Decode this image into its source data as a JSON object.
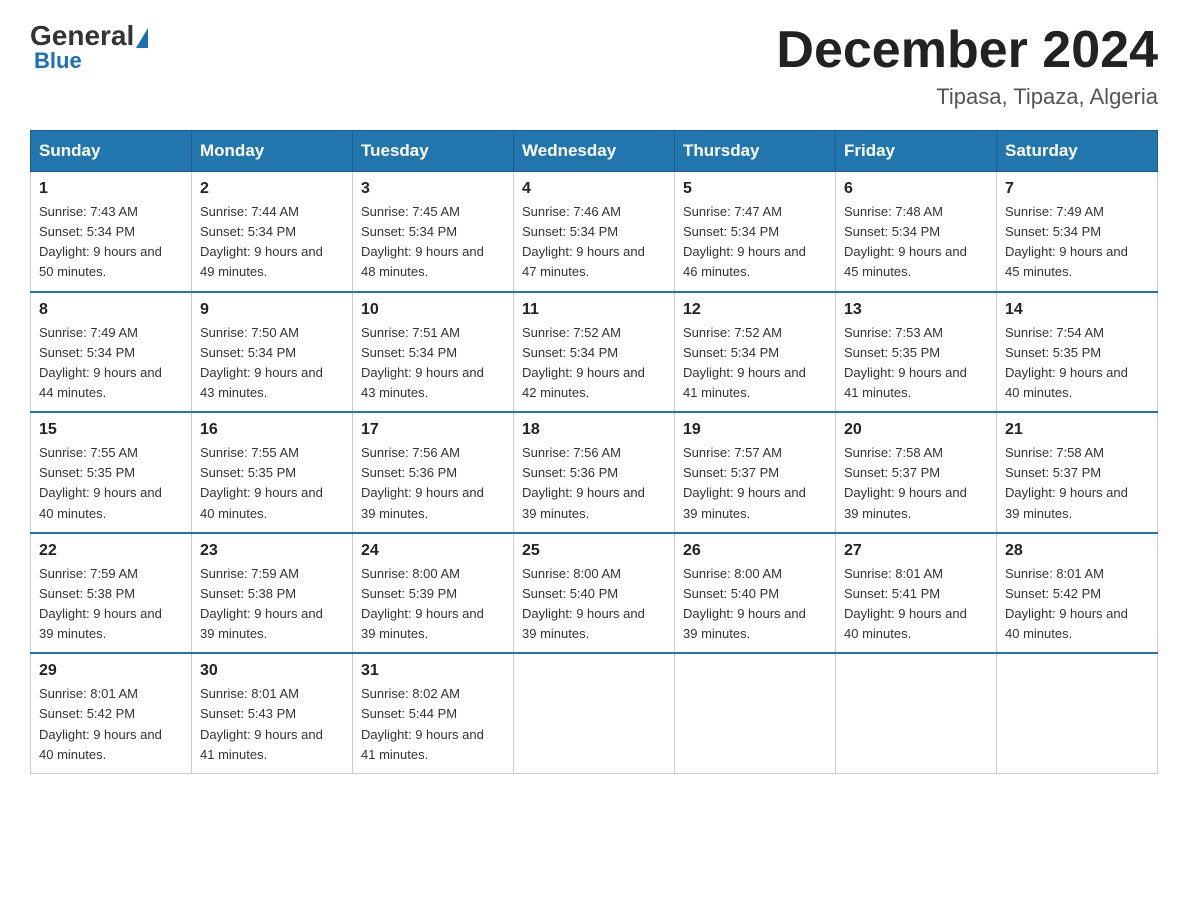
{
  "header": {
    "logo": {
      "general": "General",
      "blue": "Blue"
    },
    "title": "December 2024",
    "location": "Tipasa, Tipaza, Algeria"
  },
  "calendar": {
    "days_of_week": [
      "Sunday",
      "Monday",
      "Tuesday",
      "Wednesday",
      "Thursday",
      "Friday",
      "Saturday"
    ],
    "weeks": [
      [
        {
          "day": "1",
          "sunrise": "7:43 AM",
          "sunset": "5:34 PM",
          "daylight": "9 hours and 50 minutes."
        },
        {
          "day": "2",
          "sunrise": "7:44 AM",
          "sunset": "5:34 PM",
          "daylight": "9 hours and 49 minutes."
        },
        {
          "day": "3",
          "sunrise": "7:45 AM",
          "sunset": "5:34 PM",
          "daylight": "9 hours and 48 minutes."
        },
        {
          "day": "4",
          "sunrise": "7:46 AM",
          "sunset": "5:34 PM",
          "daylight": "9 hours and 47 minutes."
        },
        {
          "day": "5",
          "sunrise": "7:47 AM",
          "sunset": "5:34 PM",
          "daylight": "9 hours and 46 minutes."
        },
        {
          "day": "6",
          "sunrise": "7:48 AM",
          "sunset": "5:34 PM",
          "daylight": "9 hours and 45 minutes."
        },
        {
          "day": "7",
          "sunrise": "7:49 AM",
          "sunset": "5:34 PM",
          "daylight": "9 hours and 45 minutes."
        }
      ],
      [
        {
          "day": "8",
          "sunrise": "7:49 AM",
          "sunset": "5:34 PM",
          "daylight": "9 hours and 44 minutes."
        },
        {
          "day": "9",
          "sunrise": "7:50 AM",
          "sunset": "5:34 PM",
          "daylight": "9 hours and 43 minutes."
        },
        {
          "day": "10",
          "sunrise": "7:51 AM",
          "sunset": "5:34 PM",
          "daylight": "9 hours and 43 minutes."
        },
        {
          "day": "11",
          "sunrise": "7:52 AM",
          "sunset": "5:34 PM",
          "daylight": "9 hours and 42 minutes."
        },
        {
          "day": "12",
          "sunrise": "7:52 AM",
          "sunset": "5:34 PM",
          "daylight": "9 hours and 41 minutes."
        },
        {
          "day": "13",
          "sunrise": "7:53 AM",
          "sunset": "5:35 PM",
          "daylight": "9 hours and 41 minutes."
        },
        {
          "day": "14",
          "sunrise": "7:54 AM",
          "sunset": "5:35 PM",
          "daylight": "9 hours and 40 minutes."
        }
      ],
      [
        {
          "day": "15",
          "sunrise": "7:55 AM",
          "sunset": "5:35 PM",
          "daylight": "9 hours and 40 minutes."
        },
        {
          "day": "16",
          "sunrise": "7:55 AM",
          "sunset": "5:35 PM",
          "daylight": "9 hours and 40 minutes."
        },
        {
          "day": "17",
          "sunrise": "7:56 AM",
          "sunset": "5:36 PM",
          "daylight": "9 hours and 39 minutes."
        },
        {
          "day": "18",
          "sunrise": "7:56 AM",
          "sunset": "5:36 PM",
          "daylight": "9 hours and 39 minutes."
        },
        {
          "day": "19",
          "sunrise": "7:57 AM",
          "sunset": "5:37 PM",
          "daylight": "9 hours and 39 minutes."
        },
        {
          "day": "20",
          "sunrise": "7:58 AM",
          "sunset": "5:37 PM",
          "daylight": "9 hours and 39 minutes."
        },
        {
          "day": "21",
          "sunrise": "7:58 AM",
          "sunset": "5:37 PM",
          "daylight": "9 hours and 39 minutes."
        }
      ],
      [
        {
          "day": "22",
          "sunrise": "7:59 AM",
          "sunset": "5:38 PM",
          "daylight": "9 hours and 39 minutes."
        },
        {
          "day": "23",
          "sunrise": "7:59 AM",
          "sunset": "5:38 PM",
          "daylight": "9 hours and 39 minutes."
        },
        {
          "day": "24",
          "sunrise": "8:00 AM",
          "sunset": "5:39 PM",
          "daylight": "9 hours and 39 minutes."
        },
        {
          "day": "25",
          "sunrise": "8:00 AM",
          "sunset": "5:40 PM",
          "daylight": "9 hours and 39 minutes."
        },
        {
          "day": "26",
          "sunrise": "8:00 AM",
          "sunset": "5:40 PM",
          "daylight": "9 hours and 39 minutes."
        },
        {
          "day": "27",
          "sunrise": "8:01 AM",
          "sunset": "5:41 PM",
          "daylight": "9 hours and 40 minutes."
        },
        {
          "day": "28",
          "sunrise": "8:01 AM",
          "sunset": "5:42 PM",
          "daylight": "9 hours and 40 minutes."
        }
      ],
      [
        {
          "day": "29",
          "sunrise": "8:01 AM",
          "sunset": "5:42 PM",
          "daylight": "9 hours and 40 minutes."
        },
        {
          "day": "30",
          "sunrise": "8:01 AM",
          "sunset": "5:43 PM",
          "daylight": "9 hours and 41 minutes."
        },
        {
          "day": "31",
          "sunrise": "8:02 AM",
          "sunset": "5:44 PM",
          "daylight": "9 hours and 41 minutes."
        },
        null,
        null,
        null,
        null
      ]
    ]
  }
}
